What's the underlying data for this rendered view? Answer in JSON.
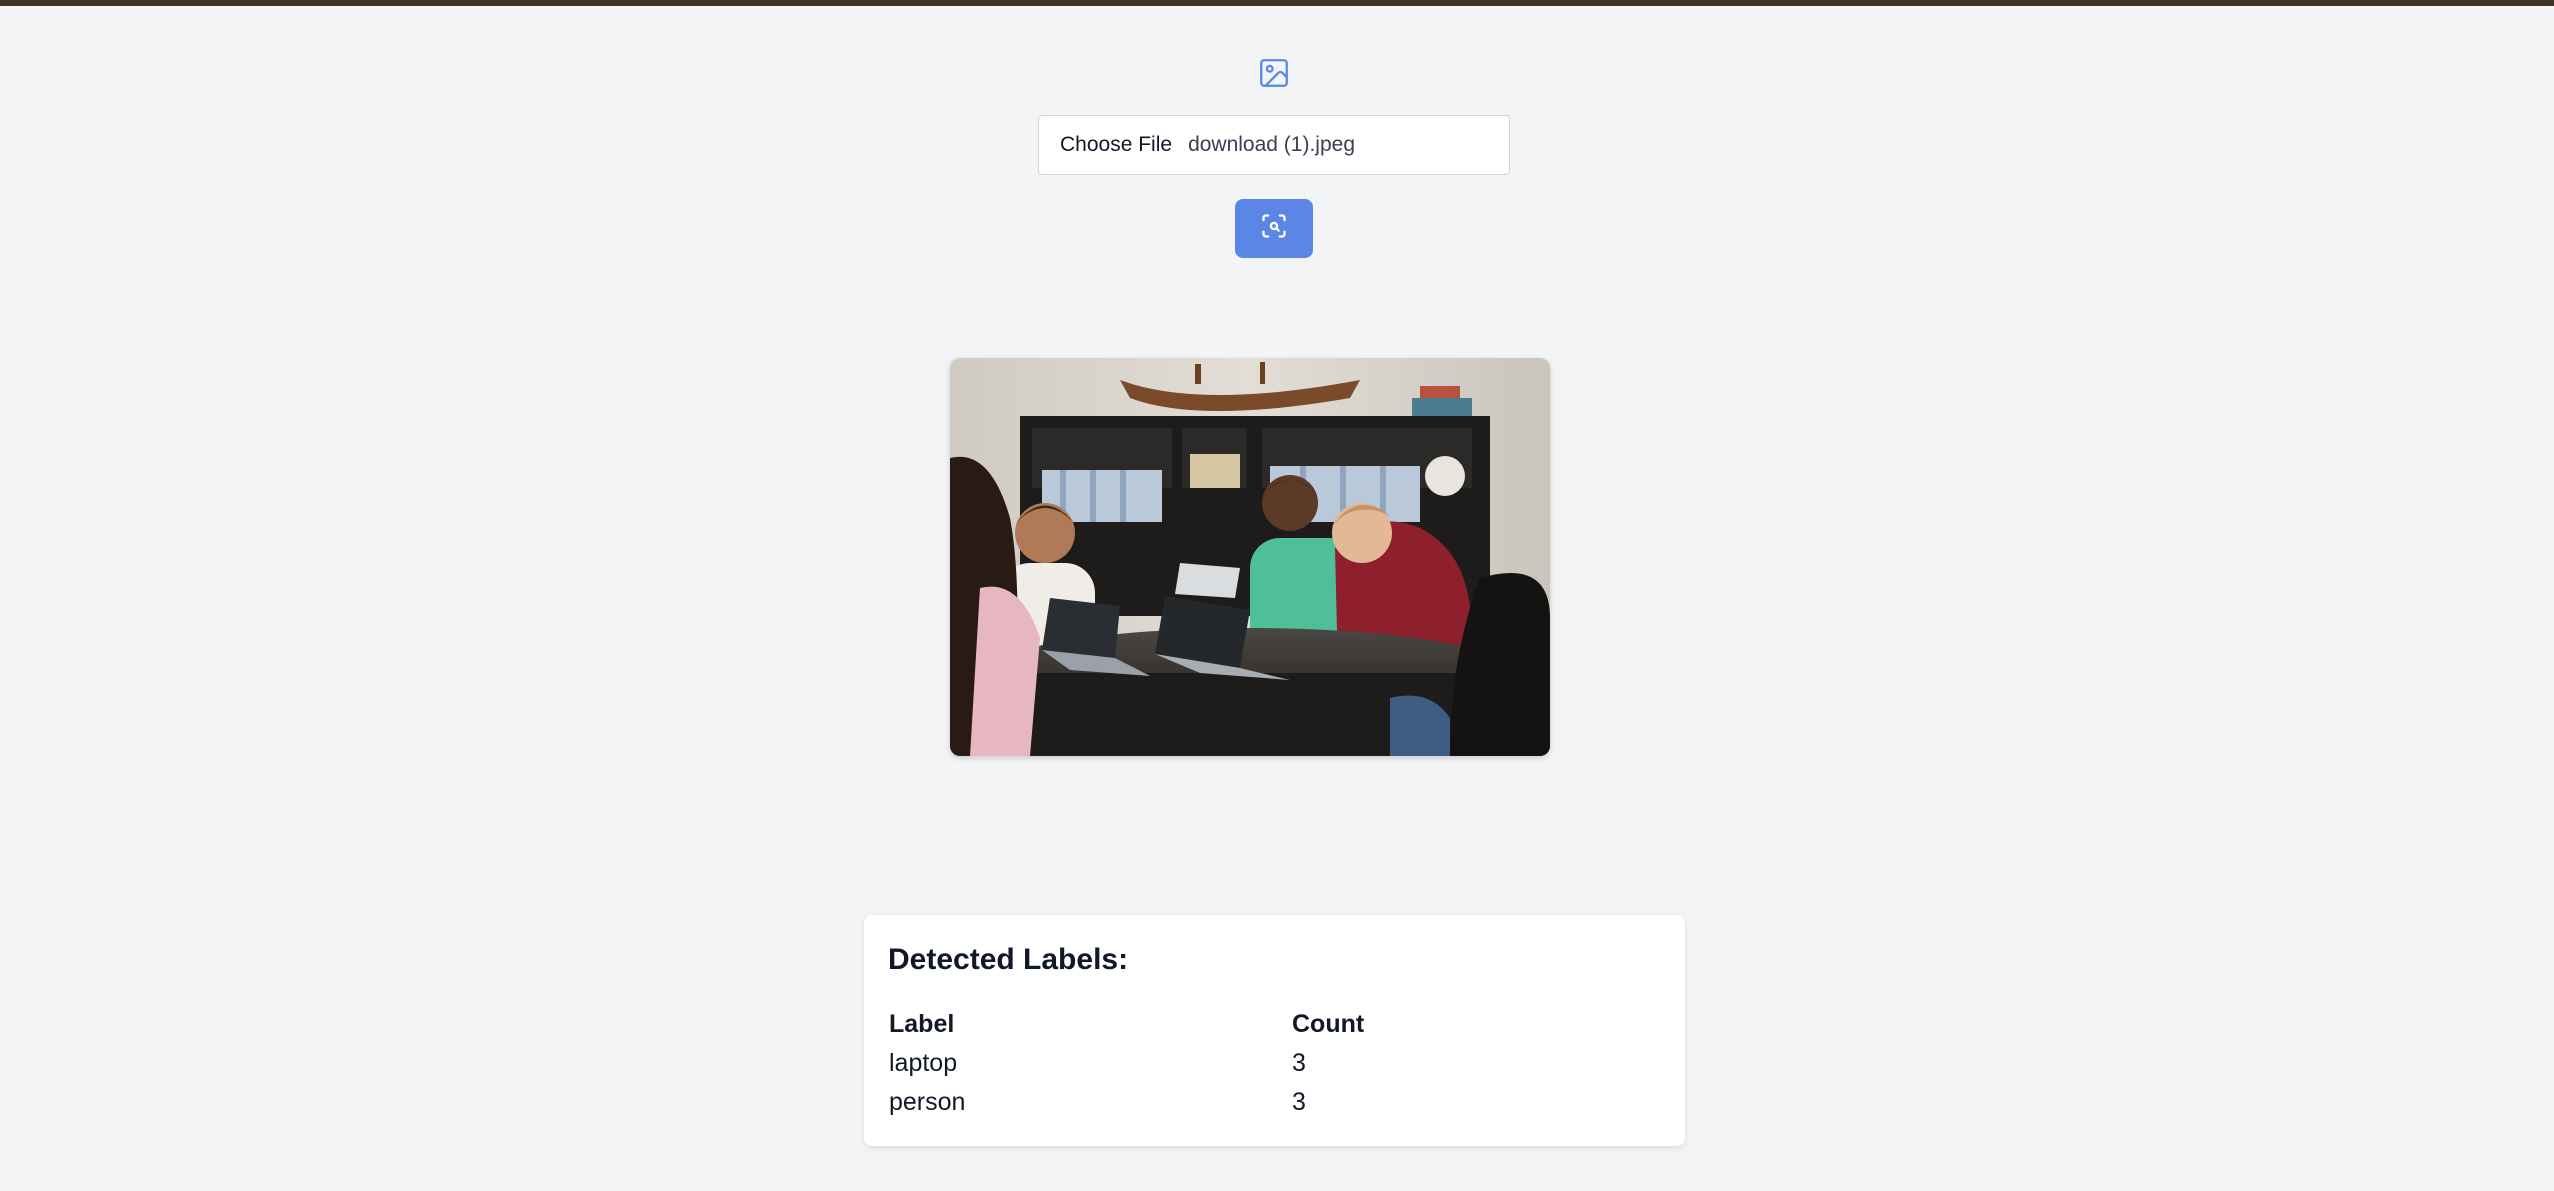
{
  "upload": {
    "icon": "image-icon",
    "choose_label": "Choose File",
    "file_name": "download (1).jpeg"
  },
  "detect_button": {
    "icon": "scan-search-icon",
    "color": "#5b86e5"
  },
  "image_preview": {
    "alt": "Students sitting around a table with laptops"
  },
  "results": {
    "title": "Detected Labels:",
    "columns": [
      "Label",
      "Count"
    ],
    "rows": [
      {
        "label": "laptop",
        "count": "3"
      },
      {
        "label": "person",
        "count": "3"
      }
    ]
  }
}
